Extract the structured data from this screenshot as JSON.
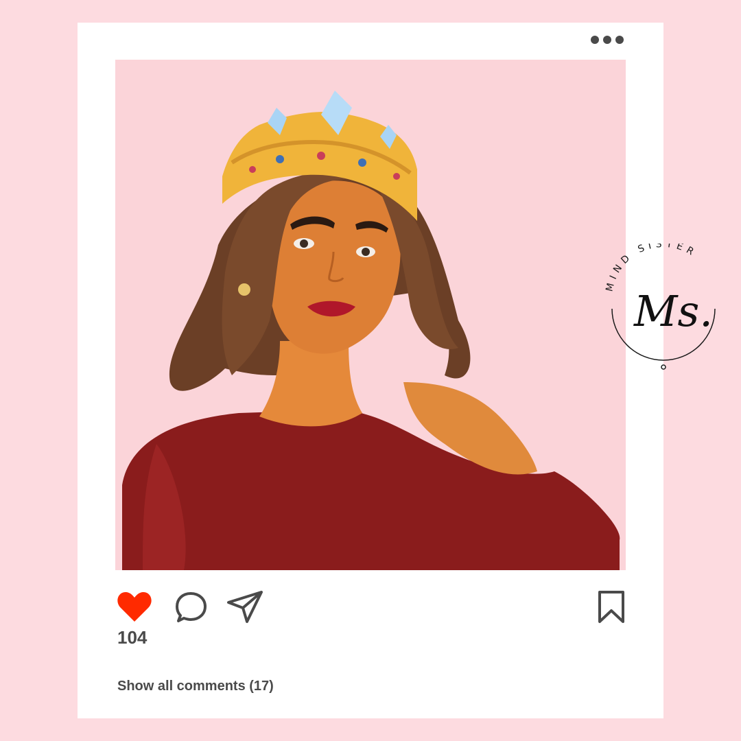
{
  "post": {
    "like_count": "104",
    "show_comments_label": "Show all comments (17)"
  },
  "icons": {
    "more": "more-options-icon",
    "like": "heart-icon",
    "comment": "comment-icon",
    "share": "send-icon",
    "save": "bookmark-icon"
  },
  "logo": {
    "ring_text": "MIND SISTER",
    "monogram": "Ms."
  },
  "colors": {
    "background": "#fddbe0",
    "photo_background": "#fbd4d9",
    "heart": "#ff2a00",
    "text": "#4a4a4a"
  }
}
